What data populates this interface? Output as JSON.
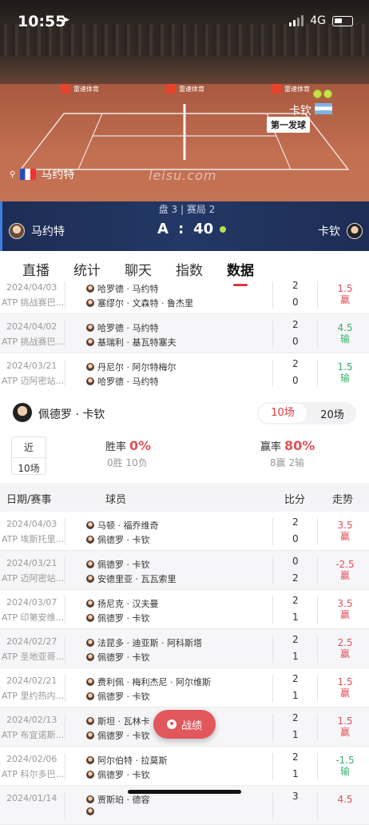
{
  "status": {
    "time": "10:55",
    "network": "4G"
  },
  "court": {
    "ad_text": "雷速体育",
    "player1_name": "马约特",
    "player2_name": "卡钦",
    "serve_badge": "第一发球",
    "watermark": "leisu.com"
  },
  "score": {
    "set_game": "盘 3 | 赛局 2",
    "player1": "马约特",
    "player2": "卡钦",
    "p1_points": "A",
    "separator": ":",
    "p2_points": "40"
  },
  "tabs": [
    "直播",
    "统计",
    "聊天",
    "指数",
    "数据"
  ],
  "active_tab": "数据",
  "top_rows": [
    {
      "date": "2024/04/03",
      "event": "ATP 挑战赛巴...",
      "p1": "哈罗德 · 马约特",
      "p2": "塞缪尔 · 文森特 · 鲁杰里",
      "s1": "2",
      "s2": "0",
      "trend_value": "1.5",
      "trend_result": "赢",
      "result": "win"
    },
    {
      "date": "2024/04/02",
      "event": "ATP 挑战赛巴...",
      "p1": "哈罗德 · 马约特",
      "p2": "基瑞利 · 基瓦特塞夫",
      "s1": "2",
      "s2": "0",
      "trend_value": "4.5",
      "trend_result": "输",
      "result": "lose"
    },
    {
      "date": "2024/03/21",
      "event": "ATP 迈阿密站...",
      "p1": "丹尼尔 · 阿尔特梅尔",
      "p2": "哈罗德 · 马约特",
      "s1": "2",
      "s2": "0",
      "trend_value": "1.5",
      "trend_result": "输",
      "result": "lose"
    }
  ],
  "player_section": {
    "name": "佩德罗 · 卡钦",
    "seg_10": "10场",
    "seg_20": "20场",
    "near_label": "近",
    "near_count": "10场",
    "win_rate_label": "胜率",
    "win_rate": "0%",
    "win_rate_sub": "0胜 10负",
    "cover_rate_label": "赢率",
    "cover_rate": "80%",
    "cover_rate_sub": "8赢 2输"
  },
  "table_header": {
    "date": "日期/赛事",
    "player": "球员",
    "score": "比分",
    "trend": "走势"
  },
  "bottom_rows": [
    {
      "date": "2024/04/03",
      "event": "ATP 埃斯托里...",
      "p1": "马顿 · 福乔维奇",
      "p2": "佩德罗 · 卡钦",
      "s1": "2",
      "s2": "0",
      "trend_value": "3.5",
      "trend_result": "赢",
      "result": "win"
    },
    {
      "date": "2024/03/21",
      "event": "ATP 迈阿密站...",
      "p1": "佩德罗 · 卡钦",
      "p2": "安德里亚 · 瓦瓦索里",
      "s1": "0",
      "s2": "2",
      "trend_value": "-2.5",
      "trend_result": "赢",
      "result": "win"
    },
    {
      "date": "2024/03/07",
      "event": "ATP 印第安维...",
      "p1": "扬尼克 · 汉夫曼",
      "p2": "佩德罗 · 卡钦",
      "s1": "2",
      "s2": "1",
      "trend_value": "3.5",
      "trend_result": "赢",
      "result": "win"
    },
    {
      "date": "2024/02/27",
      "event": "ATP 圣地亚哥...",
      "p1": "法昆多 · 迪亚斯 · 阿科斯塔",
      "p2": "佩德罗 · 卡钦",
      "s1": "2",
      "s2": "1",
      "trend_value": "2.5",
      "trend_result": "赢",
      "result": "win"
    },
    {
      "date": "2024/02/21",
      "event": "ATP 里约热内...",
      "p1": "费利佩 · 梅利杰尼 · 阿尔维斯",
      "p2": "佩德罗 · 卡钦",
      "s1": "2",
      "s2": "1",
      "trend_value": "1.5",
      "trend_result": "赢",
      "result": "win"
    },
    {
      "date": "2024/02/13",
      "event": "ATP 布宜诺斯...",
      "p1": "斯坦 · 瓦林卡",
      "p2": "佩德罗 · 卡钦",
      "s1": "2",
      "s2": "1",
      "trend_value": "1.5",
      "trend_result": "赢",
      "result": "win"
    },
    {
      "date": "2024/02/06",
      "event": "ATP 科尔多巴...",
      "p1": "阿尔伯特 · 拉莫斯",
      "p2": "佩德罗 · 卡钦",
      "s1": "2",
      "s2": "1",
      "trend_value": "-1.5",
      "trend_result": "输",
      "result": "lose"
    },
    {
      "date": "2024/01/14",
      "event": "",
      "p1": "贾斯珀 · 德容",
      "p2": "",
      "s1": "3",
      "s2": "",
      "trend_value": "4.5",
      "trend_result": "",
      "result": "win"
    }
  ],
  "fab_label": "战绩",
  "colors": {
    "accent": "#e0393e",
    "win": "#e0515a",
    "lose": "#3bb06b",
    "score_bar": "#233866"
  }
}
